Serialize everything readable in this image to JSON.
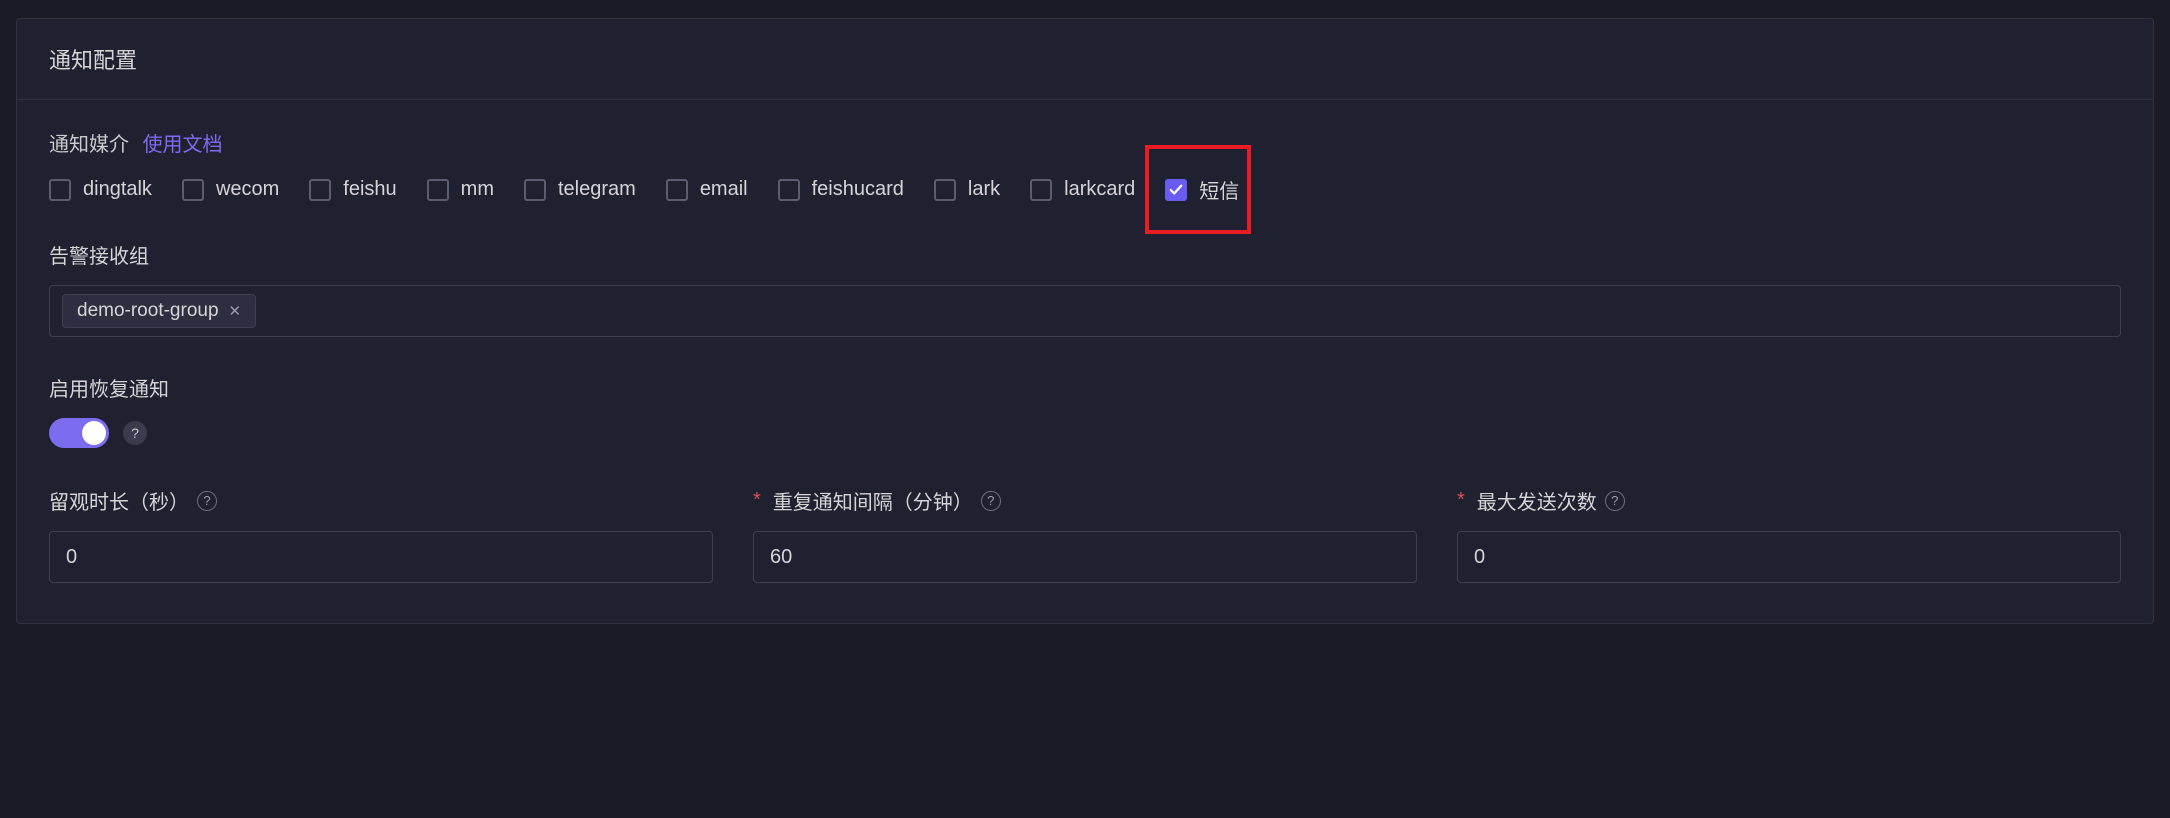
{
  "panel": {
    "title": "通知配置"
  },
  "media": {
    "label": "通知媒介",
    "docLink": "使用文档",
    "options": [
      {
        "id": "dingtalk",
        "label": "dingtalk",
        "checked": false
      },
      {
        "id": "wecom",
        "label": "wecom",
        "checked": false
      },
      {
        "id": "feishu",
        "label": "feishu",
        "checked": false
      },
      {
        "id": "mm",
        "label": "mm",
        "checked": false
      },
      {
        "id": "telegram",
        "label": "telegram",
        "checked": false
      },
      {
        "id": "email",
        "label": "email",
        "checked": false
      },
      {
        "id": "feishucard",
        "label": "feishucard",
        "checked": false
      },
      {
        "id": "lark",
        "label": "lark",
        "checked": false
      },
      {
        "id": "larkcard",
        "label": "larkcard",
        "checked": false
      },
      {
        "id": "sms",
        "label": "短信",
        "checked": true,
        "highlighted": true
      }
    ]
  },
  "receiverGroup": {
    "label": "告警接收组",
    "tags": [
      {
        "label": "demo-root-group"
      }
    ]
  },
  "recoveryNotify": {
    "label": "启用恢复通知",
    "enabled": true
  },
  "fields": {
    "observeDuration": {
      "label": "留观时长（秒）",
      "value": "0",
      "required": false,
      "help": true
    },
    "repeatInterval": {
      "label": "重复通知间隔（分钟）",
      "value": "60",
      "required": true,
      "help": true
    },
    "maxSendCount": {
      "label": "最大发送次数",
      "value": "0",
      "required": true,
      "help": true
    }
  },
  "helpGlyph": "?"
}
